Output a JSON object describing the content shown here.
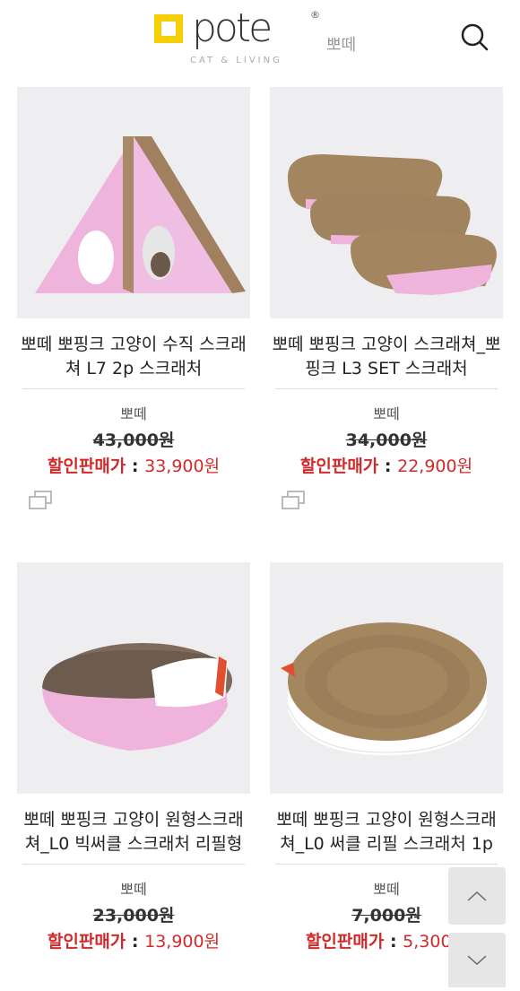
{
  "header": {
    "logo_text": "pote",
    "logo_reg": "®",
    "logo_tagline": "CAT & LIVING",
    "logo_korean": "뽀떼",
    "search_icon": "search-icon"
  },
  "products": [
    {
      "title": "뽀떼 뽀핑크 고양이 수직 스크래쳐 L7 2p 스크래처",
      "brand": "뽀떼",
      "original_price": "43,000원",
      "sale_label": "할인판매가",
      "sale_price": "33,900원"
    },
    {
      "title": "뽀떼 뽀핑크 고양이 스크래쳐_뽀핑크 L3 SET 스크래처",
      "brand": "뽀떼",
      "original_price": "34,000원",
      "sale_label": "할인판매가",
      "sale_price": "22,900원"
    },
    {
      "title": "뽀떼 뽀핑크 고양이 원형스크래쳐_L0 빅써클 스크래처 리필형",
      "brand": "뽀떼",
      "original_price": "23,000원",
      "sale_label": "할인판매가",
      "sale_price": "13,900원"
    },
    {
      "title": "뽀떼 뽀핑크 고양이 원형스크래쳐_L0 써클 리필 스크래처 1p",
      "brand": "뽀떼",
      "original_price": "7,000원",
      "sale_label": "할인판매가",
      "sale_price": "5,300원"
    }
  ],
  "colors": {
    "sale_red": "#d12a2a",
    "logo_yellow": "#f5cf00",
    "pink": "#f2b6df"
  }
}
